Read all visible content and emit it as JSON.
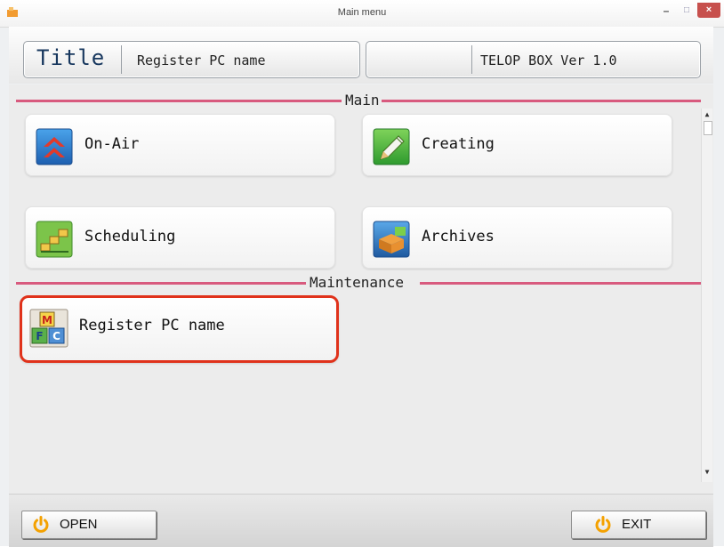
{
  "window": {
    "title": "Main menu",
    "minimize": "–",
    "maximize": "□",
    "close": "×"
  },
  "header": {
    "title_word": "Title",
    "title_value": "Register PC name",
    "version": "TELOP BOX Ver 1.0"
  },
  "sections": {
    "main": "Main",
    "maintenance": "Maintenance"
  },
  "tiles": {
    "on_air": "On-Air",
    "creating": "Creating",
    "scheduling": "Scheduling",
    "archives": "Archives",
    "register": "Register PC name"
  },
  "footer": {
    "open": "OPEN",
    "exit": "EXIT"
  },
  "colors": {
    "accent_line": "#d85a7e",
    "selection": "#e0321b",
    "title_text": "#17375e",
    "power_icon": "#f4a100"
  },
  "icons": {
    "on_air": "double-up-arrow-icon",
    "creating": "pencil-icon",
    "scheduling": "schedule-blocks-icon",
    "archives": "archive-box-icon",
    "register": "mfc-blocks-icon",
    "power": "power-icon"
  }
}
